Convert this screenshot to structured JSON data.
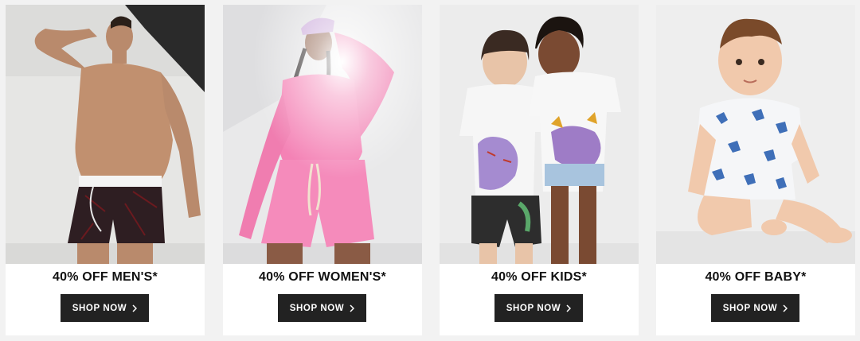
{
  "colors": {
    "page_bg": "#f2f2f2",
    "card_bg": "#ffffff",
    "button_bg": "#222222",
    "button_text": "#ffffff",
    "caption_text": "#111111"
  },
  "promos": [
    {
      "photo": "men-underwear-model-photo",
      "title": "40% OFF MEN'S*",
      "cta": "SHOP NOW",
      "cta_icon": "chevron-right-icon"
    },
    {
      "photo": "women-pink-lounge-set-photo",
      "title": "40% OFF WOMEN'S*",
      "cta": "SHOP NOW",
      "cta_icon": "chevron-right-icon"
    },
    {
      "photo": "kids-dinosaur-tees-photo",
      "title": "40% OFF KIDS*",
      "cta": "SHOP NOW",
      "cta_icon": "chevron-right-icon"
    },
    {
      "photo": "baby-dinosaur-romper-photo",
      "title": "40% OFF BABY*",
      "cta": "SHOP NOW",
      "cta_icon": "chevron-right-icon"
    }
  ]
}
